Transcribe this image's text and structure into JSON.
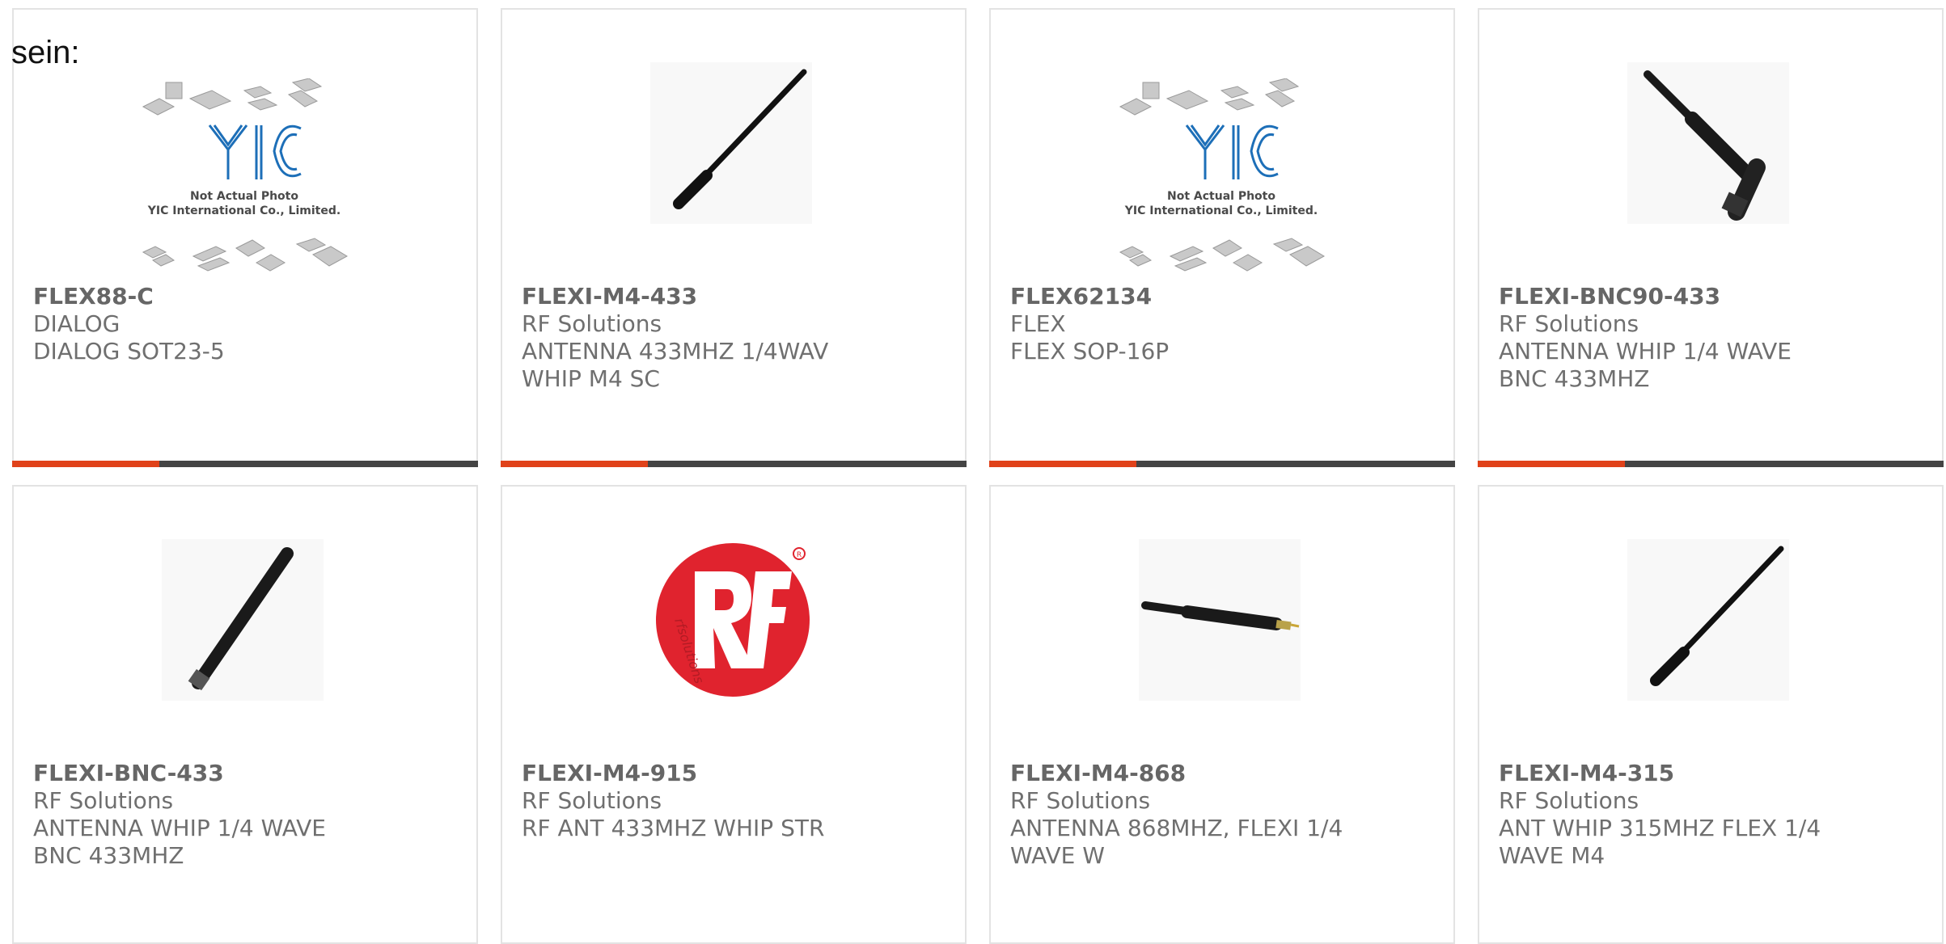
{
  "intro": {
    "text": "sein:"
  },
  "products": [
    {
      "part_number": "FLEX88-C",
      "manufacturer": "DIALOG",
      "description": "DIALOG SOT23-5",
      "image_icon": "yic-placeholder-image",
      "placeholder_brand": "YIC",
      "placeholder_line1": "Not Actual Photo",
      "placeholder_line2": "YIC International Co., Limited."
    },
    {
      "part_number": "FLEXI-M4-433",
      "manufacturer": "RF Solutions",
      "description": "ANTENNA 433MHZ 1/4WAV WHIP M4 SC",
      "image_icon": "whip-antenna-image"
    },
    {
      "part_number": "FLEX62134",
      "manufacturer": "FLEX",
      "description": "FLEX SOP-16P",
      "image_icon": "yic-placeholder-image",
      "placeholder_brand": "YIC",
      "placeholder_line1": "Not Actual Photo",
      "placeholder_line2": "YIC International Co., Limited."
    },
    {
      "part_number": "FLEXI-BNC90-433",
      "manufacturer": "RF Solutions",
      "description": "ANTENNA WHIP 1/4 WAVE BNC 433MHZ",
      "image_icon": "right-angle-bnc-antenna-image"
    },
    {
      "part_number": "FLEXI-BNC-433",
      "manufacturer": "RF Solutions",
      "description": "ANTENNA WHIP 1/4 WAVE BNC 433MHZ",
      "image_icon": "bnc-whip-antenna-image"
    },
    {
      "part_number": "FLEXI-M4-915",
      "manufacturer": "RF Solutions",
      "description": "RF ANT 433MHZ WHIP STR",
      "image_icon": "rf-solutions-logo",
      "logo_text": "rfsolutions"
    },
    {
      "part_number": "FLEXI-M4-868",
      "manufacturer": "RF Solutions",
      "description": "ANTENNA 868MHZ, FLEXI 1/4 WAVE W",
      "image_icon": "stubby-antenna-image"
    },
    {
      "part_number": "FLEXI-M4-315",
      "manufacturer": "RF Solutions",
      "description": "ANT WHIP 315MHZ FLEX 1/4 WAVE M4",
      "image_icon": "whip-antenna-image"
    }
  ],
  "colors": {
    "accent_bar": "#e0421a",
    "dark_bar": "#444444",
    "card_border": "#e3e3e3",
    "text": "#6f6f6f",
    "rf_logo_red": "#e0232e"
  }
}
